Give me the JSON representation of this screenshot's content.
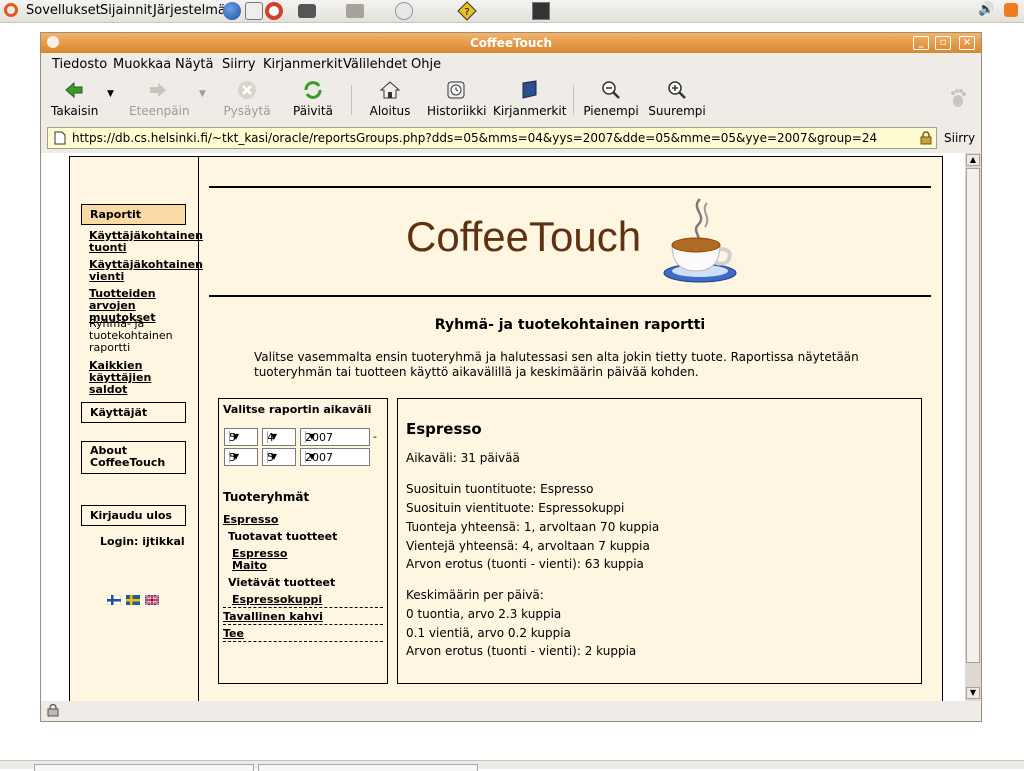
{
  "panel": {
    "menus": [
      "Sovellukset",
      "Sijainnit",
      "Järjestelmä"
    ]
  },
  "window": {
    "title": "CoffeeTouch",
    "menu": [
      "Tiedosto",
      "Muokkaa",
      "Näytä",
      "Siirry",
      "Kirjanmerkit",
      "Välilehdet",
      "Ohje"
    ],
    "toolbar": {
      "back": "Takaisin",
      "forward": "Eteenpäin",
      "stop": "Pysäytä",
      "reload": "Päivitä",
      "home": "Aloitus",
      "history": "Historiikki",
      "bookmarks": "Kirjanmerkit",
      "zoom_out": "Pienempi",
      "zoom_in": "Suurempi"
    },
    "url": "https://db.cs.helsinki.fi/~tkt_kasi/oracle/reportsGroups.php?dds=05&mms=04&yys=2007&dde=05&mme=05&yye=2007&group=24",
    "go": "Siirry"
  },
  "site": {
    "nav": {
      "reports": "Raportit",
      "user_import": "Käyttäjäkohtainen tuonti",
      "user_export": "Käyttäjäkohtainen vienti",
      "value_changes": "Tuotteiden arvojen muutokset",
      "group_report": "Ryhmä- ja tuotekohtainen raportti",
      "all_balances": "Kaikkien käyttäjien saldot",
      "users": "Käyttäjät",
      "about": "About CoffeeTouch",
      "logout": "Kirjaudu ulos",
      "login": "Login: ijtikkal"
    },
    "logo": "CoffeeTouch",
    "heading": "Ryhmä- ja tuotekohtainen raportti",
    "intro": "Valitse vasemmalta ensin tuoteryhmä ja halutessasi sen alta jokin tietty tuote. Raportissa näytetään tuoteryhmän tai tuotteen käyttö aikavälillä ja keskimäärin päivää kohden.",
    "range": {
      "label": "Valitse raportin aikaväli",
      "start": {
        "day": "5",
        "month": "4",
        "year": "2007"
      },
      "dash": "-",
      "end": {
        "day": "5",
        "month": "5",
        "year": "2007"
      }
    },
    "groups": {
      "title": "Tuoteryhmät",
      "espresso": "Espresso",
      "imported": "Tuotavat tuotteet",
      "imp1": "Espresso",
      "imp2": "Maito",
      "exported": "Vietävät tuotteet",
      "exp1": "Espressokuppi",
      "regular": "Tavallinen kahvi",
      "tea": "Tee"
    },
    "report": {
      "title": "Espresso",
      "period": "Aikaväli: 31 päivää",
      "pop_import": "Suosituin tuontituote: Espresso",
      "pop_export": "Suosituin vientituote: Espressokuppi",
      "imports_total": "Tuonteja yhteensä: 1, arvoltaan 70 kuppia",
      "exports_total": "Vientejä yhteensä: 4, arvoltaan 7 kuppia",
      "diff_total": "Arvon erotus (tuonti - vienti): 63 kuppia",
      "avg_title": "Keskimäärin per päivä:",
      "avg_imports": "0 tuontia, arvo 2.3 kuppia",
      "avg_exports": "0.1 vientiä, arvo 0.2 kuppia",
      "avg_diff": "Arvon erotus (tuonti - vienti): 2 kuppia"
    }
  }
}
